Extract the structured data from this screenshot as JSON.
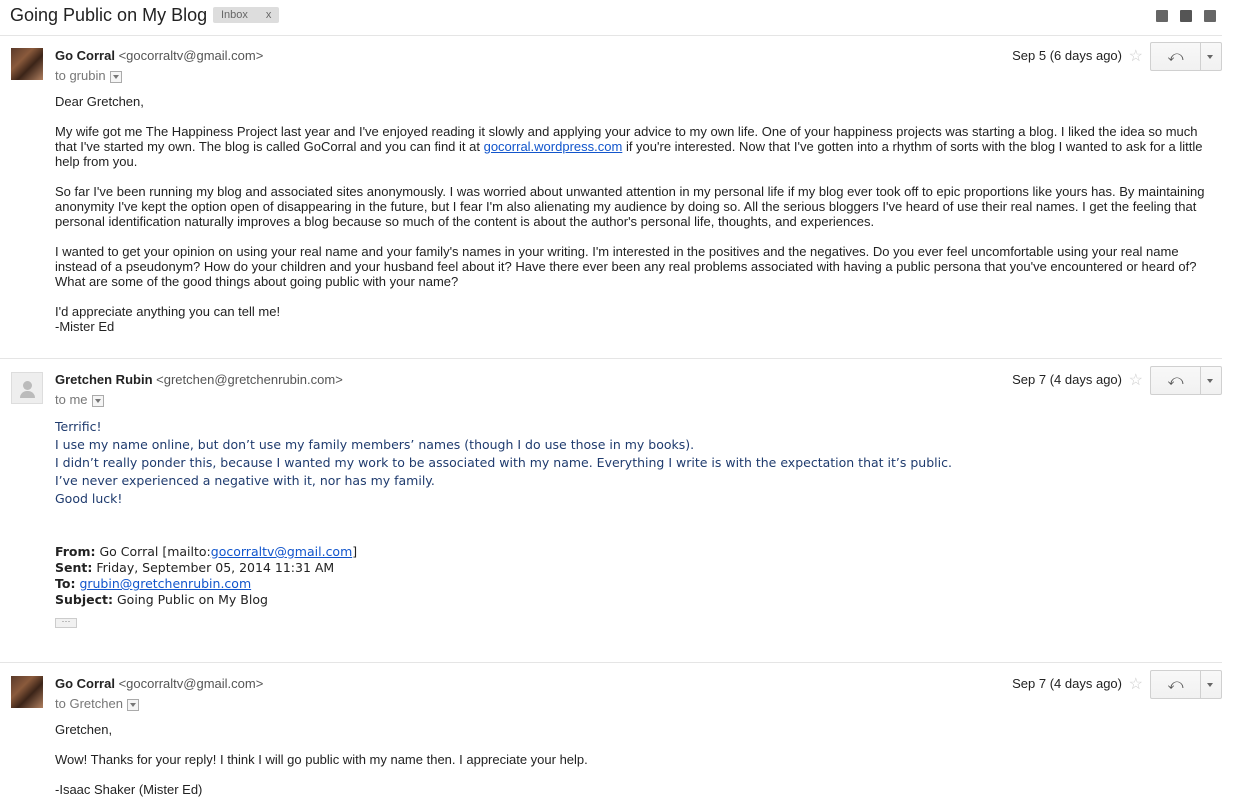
{
  "thread": {
    "subject": "Going Public on My Blog",
    "label": "Inbox",
    "label_close": "x"
  },
  "header_icons": [
    "new-window-icon",
    "print-icon",
    "popout-icon"
  ],
  "messages": [
    {
      "sender_name": "Go Corral",
      "sender_email": "<gocorraltv@gmail.com>",
      "to": "to grubin",
      "date": "Sep 5 (6 days ago)",
      "body": [
        "Dear Gretchen,",
        "My wife got me The Happiness Project last year and I've enjoyed reading it slowly and applying your advice to my own life. One of your happiness projects was starting a blog. I liked the idea so much that I've started my own. The blog is called GoCorral and you can find it at",
        "gocorral.wordpress.com",
        "if you're interested. Now that I've gotten into a rhythm of sorts with the blog I wanted to ask for a little help from you.",
        "So far I've been running my blog and associated sites anonymously. I was worried about unwanted attention in my personal life if my blog ever took off to epic proportions like yours has. By maintaining anonymity I've kept the option open of disappearing in the future, but I fear I'm also alienating my audience by doing so. All the serious bloggers I've heard of use their real names. I get the feeling that personal identification naturally improves a blog because so much of the content is about the author's personal life, thoughts, and experiences.",
        "I wanted to get your opinion on using your real name and your family's names in your writing.  I'm interested in the positives and the negatives. Do you ever feel uncomfortable using your real name instead of a pseudonym? How do your children and your husband feel about it? Have there ever been any real problems associated with having a public persona that you've encountered or heard of? What are some of the good things about going public with your name?",
        "I'd appreciate anything you can tell me!",
        "-Mister Ed"
      ]
    },
    {
      "sender_name": "Gretchen Rubin",
      "sender_email": "<gretchen@gretchenrubin.com>",
      "to": "to me",
      "date": "Sep 7 (4 days ago)",
      "body": [
        "Terrific!",
        "I use my name online, but don’t use my family members’ names (though I do use those in my books).",
        "I didn’t really ponder this, because I wanted my work to be associated with my name. Everything I write is with the expectation that it’s public.",
        "I’ve never experienced a negative with it, nor has my family.",
        "Good luck!"
      ],
      "quoted": {
        "from_label": "From:",
        "from_value": "Go Corral [mailto:",
        "from_link": "gocorraltv@gmail.com",
        "from_end": "]",
        "sent_label": "Sent:",
        "sent_value": "Friday, September 05, 2014 11:31 AM",
        "to_label": "To:",
        "to_link": "grubin@gretchenrubin.com",
        "subject_label": "Subject:",
        "subject_value": "Going Public on My Blog",
        "ellipsis": "···"
      }
    },
    {
      "sender_name": "Go Corral",
      "sender_email": "<gocorraltv@gmail.com>",
      "to": "to Gretchen",
      "date": "Sep 7 (4 days ago)",
      "body": [
        "Gretchen,",
        "Wow! Thanks for your reply! I think I will go public with my name then. I appreciate your help.",
        "-Isaac Shaker (Mister Ed)"
      ]
    }
  ],
  "star_glyph": "☆",
  "reply_glyph": "⤺"
}
